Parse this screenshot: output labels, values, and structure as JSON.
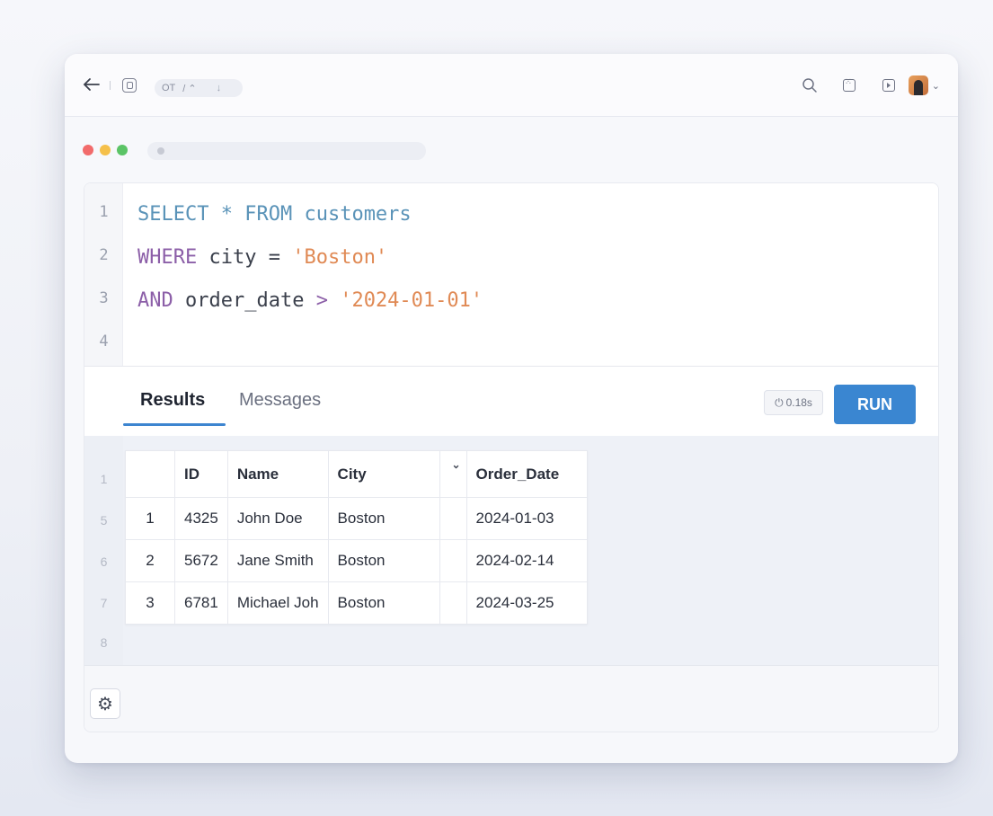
{
  "toolbar": {
    "pill_label": "OT",
    "pill_extra": "/ ⌃",
    "pill_arrow": "↓"
  },
  "editor": {
    "lines": [
      {
        "num": "1"
      },
      {
        "num": "2"
      },
      {
        "num": "3"
      },
      {
        "num": "4"
      }
    ],
    "line1": {
      "kw_select": "SELECT",
      "star": " * ",
      "kw_from": "FROM",
      "table": " customers"
    },
    "line2": {
      "kw_where": "WHERE",
      "col": " city",
      "op": " = ",
      "val": "'Boston'"
    },
    "line3": {
      "kw_and": "AND",
      "col": " order_date",
      "op": " > ",
      "val": "'2024-01-01'"
    }
  },
  "tabs": {
    "results": "Results",
    "messages": "Messages"
  },
  "status": {
    "timing": "0.18s",
    "timing_icon": "⏻"
  },
  "run_button": "RUN",
  "results_gutter": [
    "1",
    "5",
    "6",
    "7",
    "8"
  ],
  "table": {
    "headers": [
      "",
      "ID",
      "Name",
      "City",
      "",
      "Order_Date"
    ],
    "rows": [
      [
        "1",
        "4325",
        "John Doe",
        "Boston",
        "",
        "2024-01-03"
      ],
      [
        "2",
        "5672",
        "Jane Smith",
        "Boston",
        "",
        "2024-02-14"
      ],
      [
        "3",
        "6781",
        "Michael Joh",
        "Boston",
        "",
        "2024-03-25"
      ]
    ]
  },
  "colors": {
    "accent": "#3a86d1",
    "keyword": "#5a93b8",
    "keyword_alt": "#8c5fa8",
    "string": "#e08a55",
    "traffic_red": "#f26b6b",
    "traffic_yellow": "#f5c04a",
    "traffic_green": "#5bc466"
  },
  "icons": [
    "back-arrow-icon",
    "database-icon",
    "search-icon",
    "grid-icon",
    "play-icon",
    "avatar",
    "chevron-down-icon",
    "filter-chevron-icon",
    "gear-icon",
    "power-icon"
  ]
}
